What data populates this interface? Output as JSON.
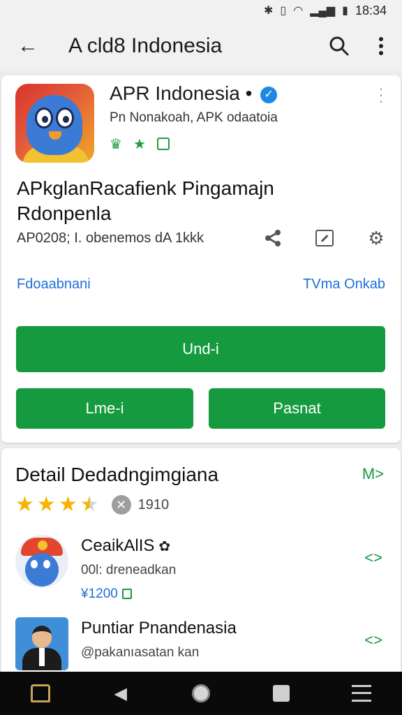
{
  "status_bar": {
    "time": "18:34"
  },
  "app_bar": {
    "title": "A cld8 Indonesia"
  },
  "app": {
    "name": "APR Indonesia",
    "developer": "Pn Nonakoah, APK odaatoia",
    "headline": "APkglanRacafienk Pingamajn Rdonpenla",
    "meta": "AP0208; I. obenemos dA 1kkk",
    "link_left": "Fdoaabnani",
    "link_right": "TVma Onkab",
    "primary_button": "Und-i",
    "secondary_button_left": "Lme-i",
    "secondary_button_right": "Pasnat"
  },
  "detail": {
    "title": "Detail  Dedadngimgiana",
    "more": "M>",
    "rating": 3.5,
    "rating_count": "1910",
    "items": [
      {
        "title": "CeaikAlIS",
        "subtitle": "00l: dreneadkan",
        "price": "¥1200"
      },
      {
        "title": "Puntiar Pnandenasia",
        "subtitle": "@pakanıasatan kan",
        "price": ""
      }
    ]
  },
  "colors": {
    "accent_green": "#169a3f",
    "link_blue": "#1e6fd9",
    "verified_blue": "#1e88e5",
    "star_yellow": "#f5b400"
  }
}
